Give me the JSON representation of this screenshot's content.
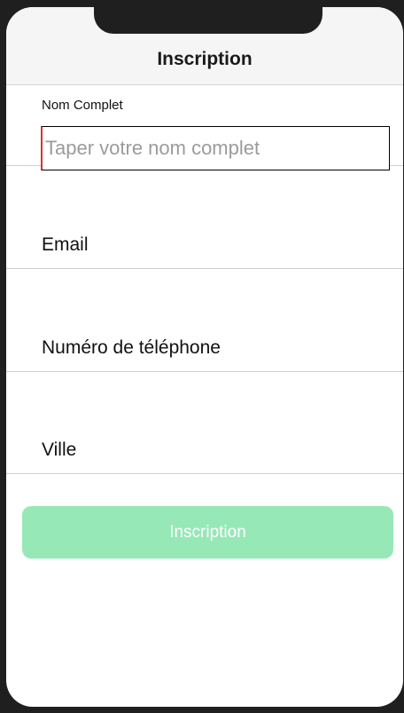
{
  "header": {
    "title": "Inscription"
  },
  "form": {
    "name_label": "Nom Complet",
    "name_placeholder": "Taper votre nom complet",
    "email_label": "Email",
    "phone_label": "Numéro de téléphone",
    "city_label": "Ville"
  },
  "submit": {
    "label": "Inscription",
    "color": "#97e8b7",
    "text_color": "#ffffff"
  },
  "colors": {
    "header_bg": "#f5f5f5",
    "frame": "#1f1f1f",
    "caret": "#d8342c"
  }
}
